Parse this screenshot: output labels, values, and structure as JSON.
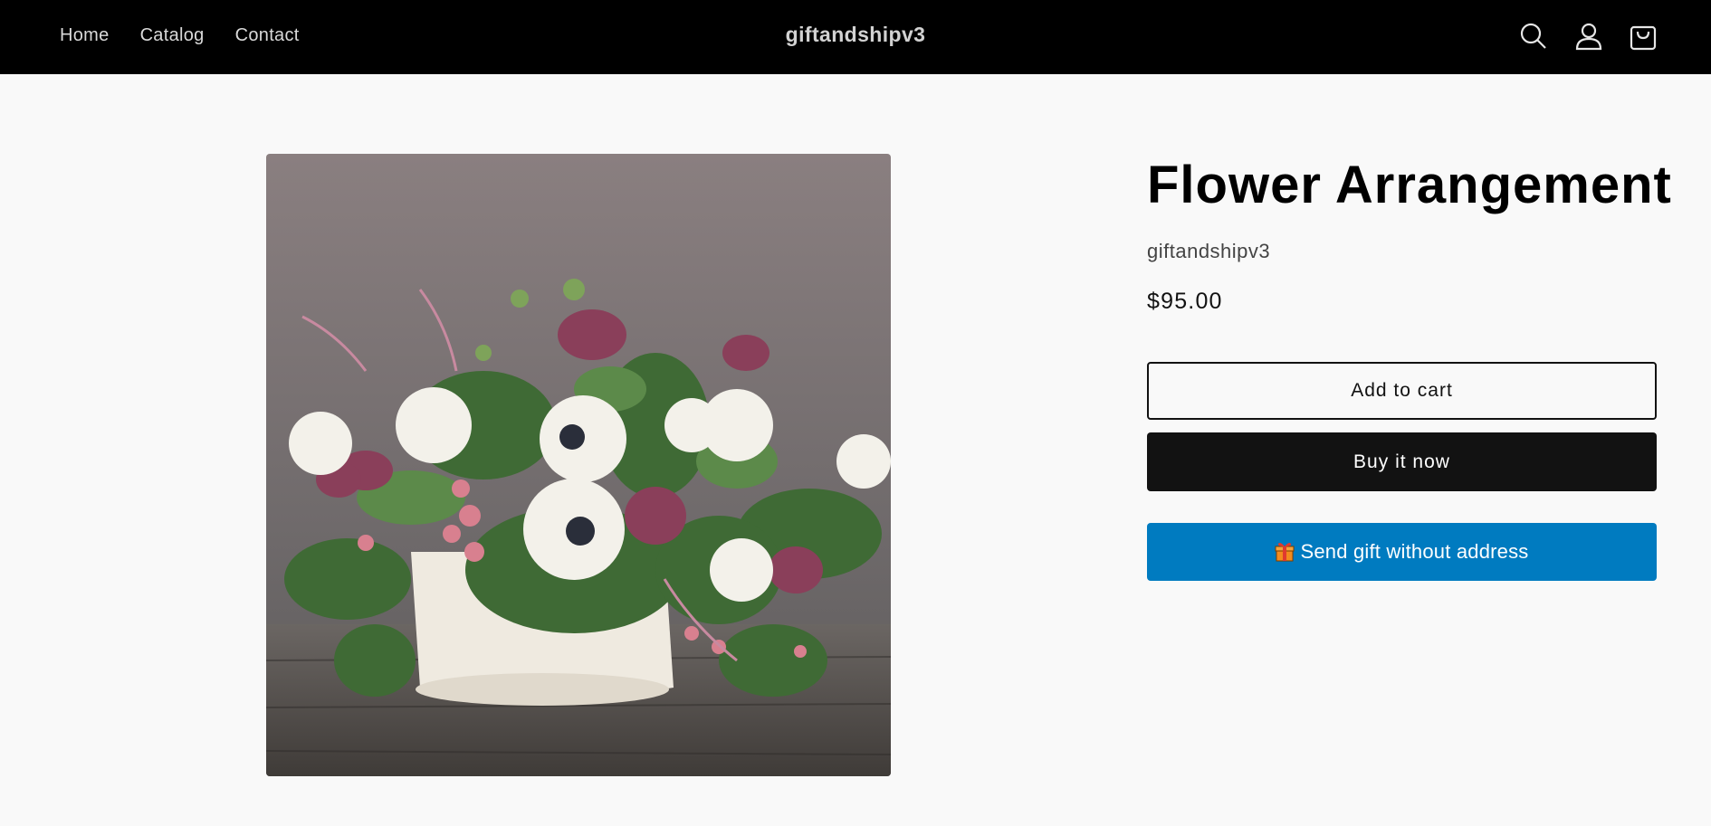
{
  "header": {
    "nav": [
      "Home",
      "Catalog",
      "Contact"
    ],
    "brand": "giftandshipv3",
    "icons": [
      "search-icon",
      "account-icon",
      "cart-icon"
    ]
  },
  "product": {
    "title": "Flower Arrangement",
    "vendor": "giftandshipv3",
    "price": "$95.00",
    "image_alt": "Flower Arrangement"
  },
  "actions": {
    "add_to_cart": "Add to cart",
    "buy_now": "Buy it now",
    "send_gift": "Send gift without address",
    "send_gift_icon": "gift-icon"
  },
  "colors": {
    "header_bg": "#000000",
    "buy_button": "#121212",
    "gift_button": "#007bc0",
    "page_bg": "#f9f9f9"
  }
}
